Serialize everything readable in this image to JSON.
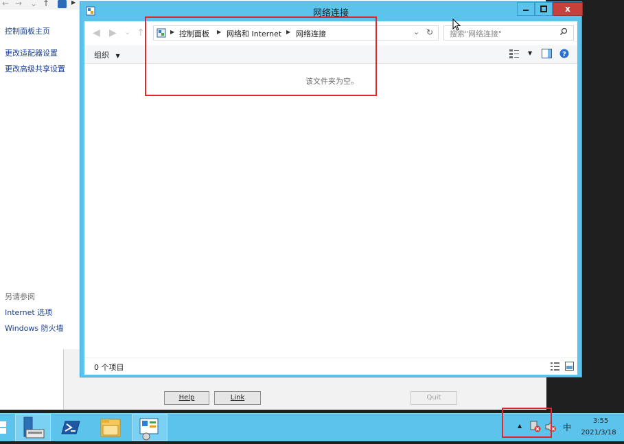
{
  "background_window": {
    "sidebar": {
      "home_link": "控制面板主页",
      "adapter_settings_link": "更改适配器设置",
      "sharing_settings_link": "更改高级共享设置",
      "see_also_heading": "另请参阅",
      "internet_options_link": "Internet 选项",
      "firewall_link": "Windows 防火墙"
    },
    "buttons": {
      "help": "Help",
      "link": "Link",
      "quit": "Quit"
    }
  },
  "window": {
    "title": "网络连接",
    "close_symbol": "x",
    "breadcrumb": [
      "控制面板",
      "网络和 Internet",
      "网络连接"
    ],
    "search_placeholder": "搜索\"网络连接\"",
    "organize_label": "组织",
    "empty_message": "该文件夹为空。",
    "status_count": "0 个项目"
  },
  "taskbar": {
    "apps": [
      "server-manager-icon",
      "powershell-icon",
      "file-explorer-icon",
      "control-panel-icon"
    ],
    "ime_label": "中",
    "clock_time": "3:55",
    "clock_date": "2021/3/18"
  },
  "colors": {
    "accent": "#5cc4ec",
    "close_button": "#c7403a",
    "highlight_box": "#e0262a",
    "link": "#1a3e8e"
  }
}
